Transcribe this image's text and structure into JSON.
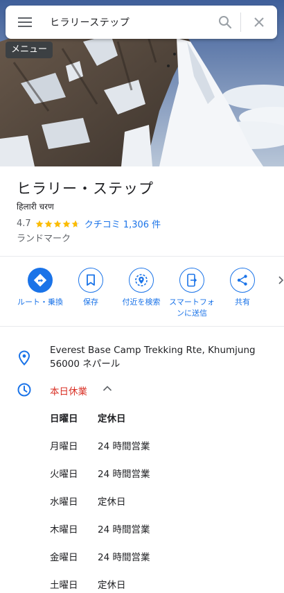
{
  "search": {
    "query": "ヒラリーステップ"
  },
  "tooltip": {
    "text": "メニュー"
  },
  "place": {
    "title": "ヒラリー・ステップ",
    "subtitle": "हिलारी चरण",
    "rating": "4.7",
    "rating_value": 4.7,
    "reviews_label": "クチコミ 1,306 件",
    "category": "ランドマーク"
  },
  "actions": [
    {
      "label": "ルート・乗換",
      "icon": "directions-icon"
    },
    {
      "label": "保存",
      "icon": "bookmark-icon"
    },
    {
      "label": "付近を検索",
      "icon": "nearby-icon"
    },
    {
      "label": "スマートフォンに送信",
      "icon": "send-to-phone-icon"
    },
    {
      "label": "共有",
      "icon": "share-icon"
    }
  ],
  "address": "Everest Base Camp Trekking Rte, Khumjung 56000 ネパール",
  "hours": {
    "status": "本日休業",
    "days": [
      {
        "day": "日曜日",
        "time": "定休日"
      },
      {
        "day": "月曜日",
        "time": "24 時間営業"
      },
      {
        "day": "火曜日",
        "time": "24 時間営業"
      },
      {
        "day": "水曜日",
        "time": "定休日"
      },
      {
        "day": "木曜日",
        "time": "24 時間営業"
      },
      {
        "day": "金曜日",
        "time": "24 時間営業"
      },
      {
        "day": "土曜日",
        "time": "定休日"
      }
    ]
  },
  "colors": {
    "accent": "#1a73e8",
    "closed": "#d93025",
    "star": "#fbbc04"
  }
}
